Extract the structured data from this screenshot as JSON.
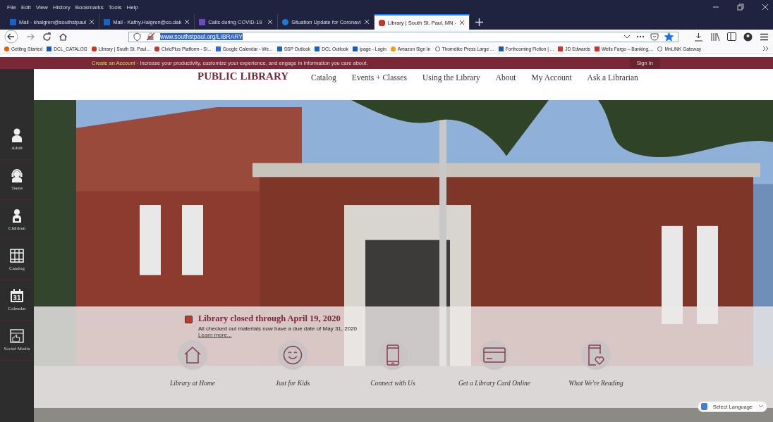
{
  "menu_bar": [
    "File",
    "Edit",
    "View",
    "History",
    "Bookmarks",
    "Tools",
    "Help"
  ],
  "tabs": [
    {
      "label": "Mail - khalgren@southstpaul",
      "selected": false
    },
    {
      "label": "Mail - Kathy.Halgren@co.dak",
      "selected": false
    },
    {
      "label": "Calls during COVID-19",
      "selected": false
    },
    {
      "label": "Situation Update for Coronavi",
      "selected": false
    },
    {
      "label": "Library | South St. Paul, MN -",
      "selected": true
    }
  ],
  "address_bar": {
    "url": "www.southstpaul.org/LIBRARY",
    "highlighted": true,
    "bookmarked": true
  },
  "bookmarks": [
    "Getting Started",
    "DCL_CATALOG",
    "Library | South St. Paul...",
    "CivicPlus Platform - Si...",
    "Google Calendar - We...",
    "SSP Outlook",
    "DCL Outlook",
    "ipage - Login",
    "Amazon Sign In",
    "Thorndike Press Large ...",
    "Forthcoming Fiction | ...",
    "JD Edwards",
    "Wells Fargo – Banking,...",
    "MnLINK Gateway"
  ],
  "banner": {
    "link": "Create an Account",
    "text": " - Increase your productivity, customize your experience, and engage in information you care about.",
    "button": "Sign In"
  },
  "site_header": {
    "logo": "PUBLIC LIBRARY",
    "nav": [
      "Catalog",
      "Events + Classes",
      "Using the Library",
      "About",
      "My Account",
      "Ask a Librarian"
    ]
  },
  "sidebar": [
    {
      "label": "Adult",
      "kind": "person"
    },
    {
      "label": "Teens",
      "kind": "headphones"
    },
    {
      "label": "Children",
      "kind": "child"
    },
    {
      "label": "Catalog",
      "kind": "catalog"
    },
    {
      "label": "Calendar",
      "kind": "calendar",
      "number": "31"
    },
    {
      "label": "Social Media",
      "kind": "social"
    }
  ],
  "alert": {
    "title": "Library closed through April 19, 2020",
    "text": "All checked out materials now have a due date of May 31, 2020",
    "link": "Learn more..."
  },
  "quick_links": [
    {
      "label": "Library at Home",
      "kind": "home"
    },
    {
      "label": "Just for Kids",
      "kind": "smile"
    },
    {
      "label": "Connect with Us",
      "kind": "phone"
    },
    {
      "label": "Get a Library Card Online",
      "kind": "card"
    },
    {
      "label": "What We're Reading",
      "kind": "book"
    }
  ],
  "translate": {
    "label": "Select Language"
  }
}
